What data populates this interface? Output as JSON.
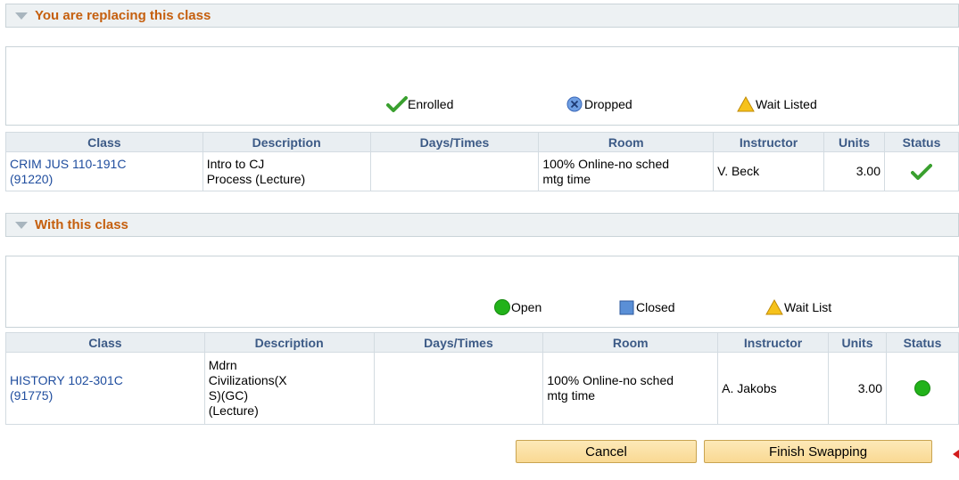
{
  "replacing": {
    "title": "You are replacing this class",
    "legend": {
      "enrolled": "Enrolled",
      "dropped": "Dropped",
      "wait_listed": "Wait Listed"
    },
    "columns": [
      "Class",
      "Description",
      "Days/Times",
      "Room",
      "Instructor",
      "Units",
      "Status"
    ],
    "row": {
      "class_line1": "CRIM JUS 110-191C",
      "class_line2": "(91220)",
      "desc_line1": "Intro to CJ",
      "desc_line2": "Process (Lecture)",
      "days_times": "",
      "room_line1": "100% Online-no sched",
      "room_line2": "mtg time",
      "instructor": "V. Beck",
      "units": "3.00",
      "status_icon": "enrolled-check-icon"
    }
  },
  "with_class": {
    "title": "With this class",
    "legend": {
      "open": "Open",
      "closed": "Closed",
      "wait_list": "Wait List"
    },
    "columns": [
      "Class",
      "Description",
      "Days/Times",
      "Room",
      "Instructor",
      "Units",
      "Status"
    ],
    "row": {
      "class_line1": "HISTORY 102-301C",
      "class_line2": "(91775)",
      "desc_line1": "Mdrn",
      "desc_line2": "Civilizations(X",
      "desc_line3": "S)(GC)",
      "desc_line4": "(Lecture)",
      "days_times": "",
      "room_line1": "100% Online-no sched",
      "room_line2": "mtg time",
      "instructor": "A. Jakobs",
      "units": "3.00",
      "status_icon": "open-circle-icon"
    }
  },
  "buttons": {
    "cancel": "Cancel",
    "finish": "Finish Swapping"
  },
  "colors": {
    "section_title": "#c55f0e",
    "header_text": "#3c5a86",
    "link": "#1f4d9e",
    "enrolled": "#3aa02f",
    "open": "#22b21a",
    "closed": "#5a8fd6",
    "wait": "#f6c21b",
    "button_bg": "#f9d993"
  }
}
